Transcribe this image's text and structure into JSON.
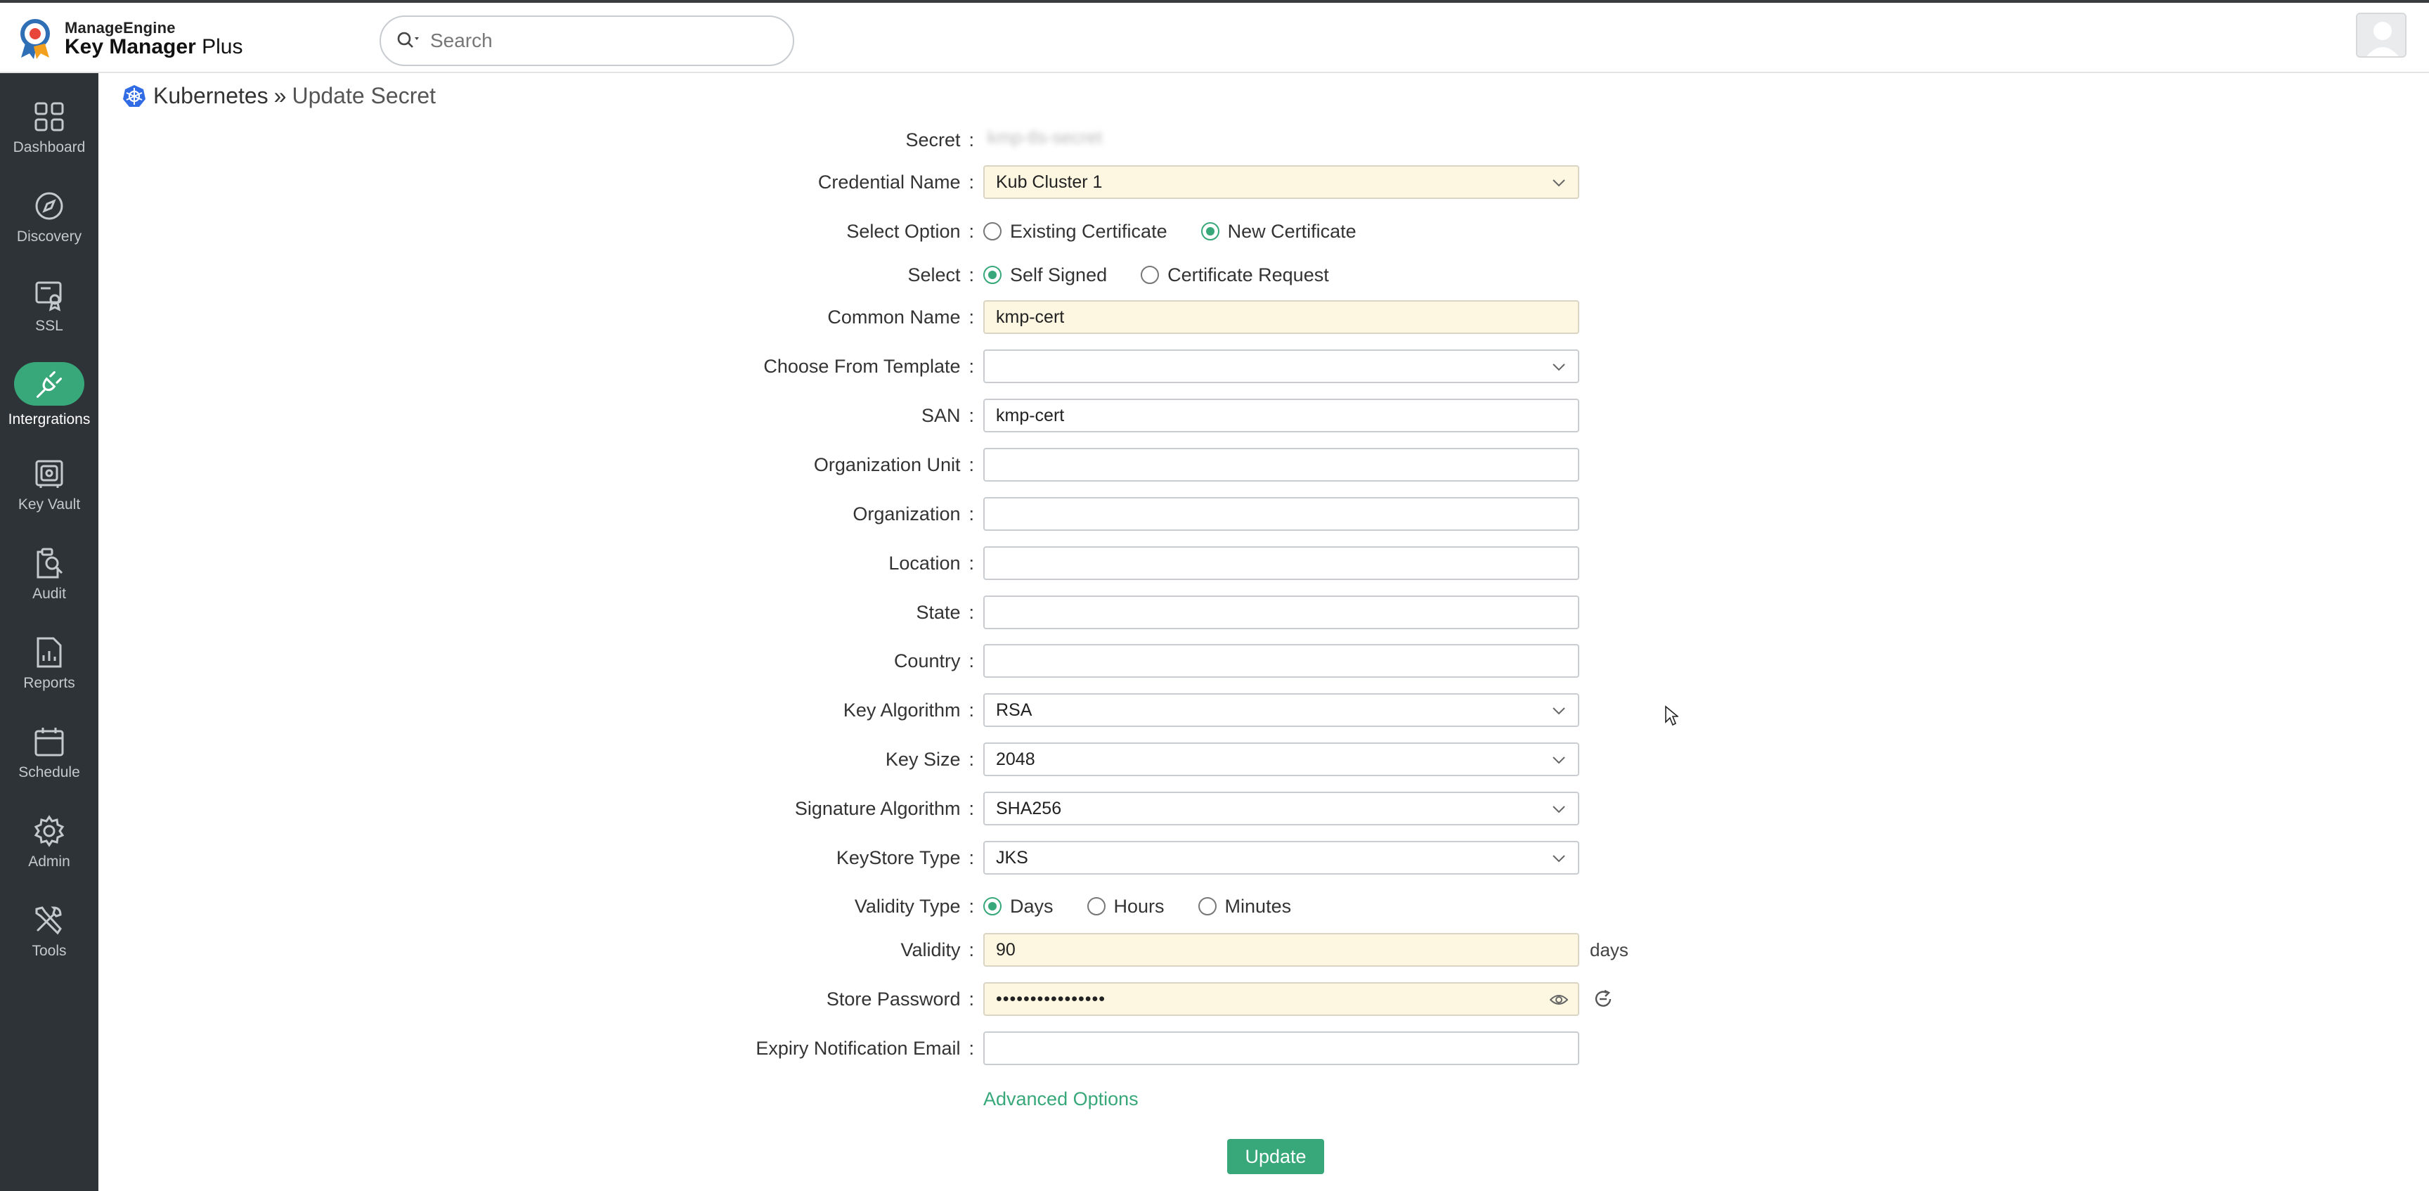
{
  "app": {
    "brand_line1": "ManageEngine",
    "brand_line2_bold": "Key Manager",
    "brand_line2_rest": " Plus",
    "accent_color": "#38a87a",
    "sidebar_bg": "#2e3338"
  },
  "search": {
    "placeholder": "Search",
    "icon": "search-icon"
  },
  "sidebar": {
    "items": [
      {
        "label": "Dashboard",
        "icon": "dashboard-icon",
        "active": false
      },
      {
        "label": "Discovery",
        "icon": "compass-icon",
        "active": false
      },
      {
        "label": "SSL",
        "icon": "certificate-icon",
        "active": false
      },
      {
        "label": "Intergrations",
        "icon": "plug-icon",
        "active": true
      },
      {
        "label": "Key Vault",
        "icon": "vault-icon",
        "active": false
      },
      {
        "label": "Audit",
        "icon": "audit-icon",
        "active": false
      },
      {
        "label": "Reports",
        "icon": "reports-icon",
        "active": false
      },
      {
        "label": "Schedule",
        "icon": "calendar-icon",
        "active": false
      },
      {
        "label": "Admin",
        "icon": "gear-icon",
        "active": false
      },
      {
        "label": "Tools",
        "icon": "tools-icon",
        "active": false
      }
    ]
  },
  "breadcrumb": {
    "parent": "Kubernetes",
    "separator": "»",
    "current": "Update Secret"
  },
  "form": {
    "colon": ":",
    "secret": {
      "label": "Secret",
      "value": "kmp-tls-secret"
    },
    "credential_name": {
      "label": "Credential Name",
      "value": "Kub Cluster 1"
    },
    "select_option": {
      "label": "Select Option",
      "options": [
        "Existing Certificate",
        "New Certificate"
      ],
      "selected": "New Certificate"
    },
    "select": {
      "label": "Select",
      "options": [
        "Self Signed",
        "Certificate Request"
      ],
      "selected": "Self Signed"
    },
    "common_name": {
      "label": "Common Name",
      "value": "kmp-cert"
    },
    "template": {
      "label": "Choose From Template",
      "value": ""
    },
    "san": {
      "label": "SAN",
      "value": "kmp-cert"
    },
    "org_unit": {
      "label": "Organization Unit",
      "value": ""
    },
    "organization": {
      "label": "Organization",
      "value": ""
    },
    "location": {
      "label": "Location",
      "value": ""
    },
    "state": {
      "label": "State",
      "value": ""
    },
    "country": {
      "label": "Country",
      "value": ""
    },
    "key_algorithm": {
      "label": "Key Algorithm",
      "value": "RSA"
    },
    "key_size": {
      "label": "Key Size",
      "value": "2048"
    },
    "signature_algorithm": {
      "label": "Signature Algorithm",
      "value": "SHA256"
    },
    "keystore_type": {
      "label": "KeyStore Type",
      "value": "JKS"
    },
    "validity_type": {
      "label": "Validity Type",
      "options": [
        "Days",
        "Hours",
        "Minutes"
      ],
      "selected": "Days"
    },
    "validity": {
      "label": "Validity",
      "value": "90",
      "suffix": "days"
    },
    "store_password": {
      "label": "Store Password",
      "value": "••••••••••••••••"
    },
    "expiry_email": {
      "label": "Expiry Notification Email",
      "value": ""
    },
    "advanced_options": "Advanced Options",
    "update_button": "Update"
  }
}
